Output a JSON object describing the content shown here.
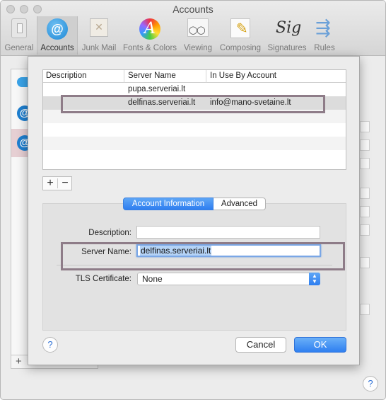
{
  "window": {
    "title": "Accounts"
  },
  "toolbar": {
    "items": [
      {
        "label": "General",
        "icon": "general-icon"
      },
      {
        "label": "Accounts",
        "icon": "accounts-icon"
      },
      {
        "label": "Junk Mail",
        "icon": "junk-mail-icon"
      },
      {
        "label": "Fonts & Colors",
        "icon": "fonts-colors-icon"
      },
      {
        "label": "Viewing",
        "icon": "viewing-icon"
      },
      {
        "label": "Composing",
        "icon": "composing-icon"
      },
      {
        "label": "Signatures",
        "icon": "signatures-icon"
      },
      {
        "label": "Rules",
        "icon": "rules-icon"
      }
    ],
    "active": "Accounts"
  },
  "sidebar": {
    "add_label": "+",
    "account_icon_glyph": "@"
  },
  "sheet": {
    "table": {
      "columns": [
        "Description",
        "Server Name",
        "In Use By Account"
      ],
      "rows": [
        {
          "description": "",
          "server_name": "pupa.serveriai.lt",
          "in_use_by": ""
        },
        {
          "description": "",
          "server_name": "delfinas.serveriai.lt",
          "in_use_by": "info@mano-svetaine.lt"
        }
      ],
      "selected_row": 1
    },
    "add_label": "+",
    "remove_label": "−",
    "tabs": {
      "account_information": "Account Information",
      "advanced": "Advanced",
      "active": "Account Information"
    },
    "form": {
      "description_label": "Description:",
      "description_value": "",
      "server_name_label": "Server Name:",
      "server_name_value": "delfinas.serveriai.lt",
      "tls_label": "TLS Certificate:",
      "tls_value": "None"
    },
    "help_label": "?",
    "cancel_label": "Cancel",
    "ok_label": "OK"
  },
  "colors": {
    "accent": "#2f7ff0",
    "highlight_box": "#8e7c88",
    "selection": "#b5d3f6"
  }
}
